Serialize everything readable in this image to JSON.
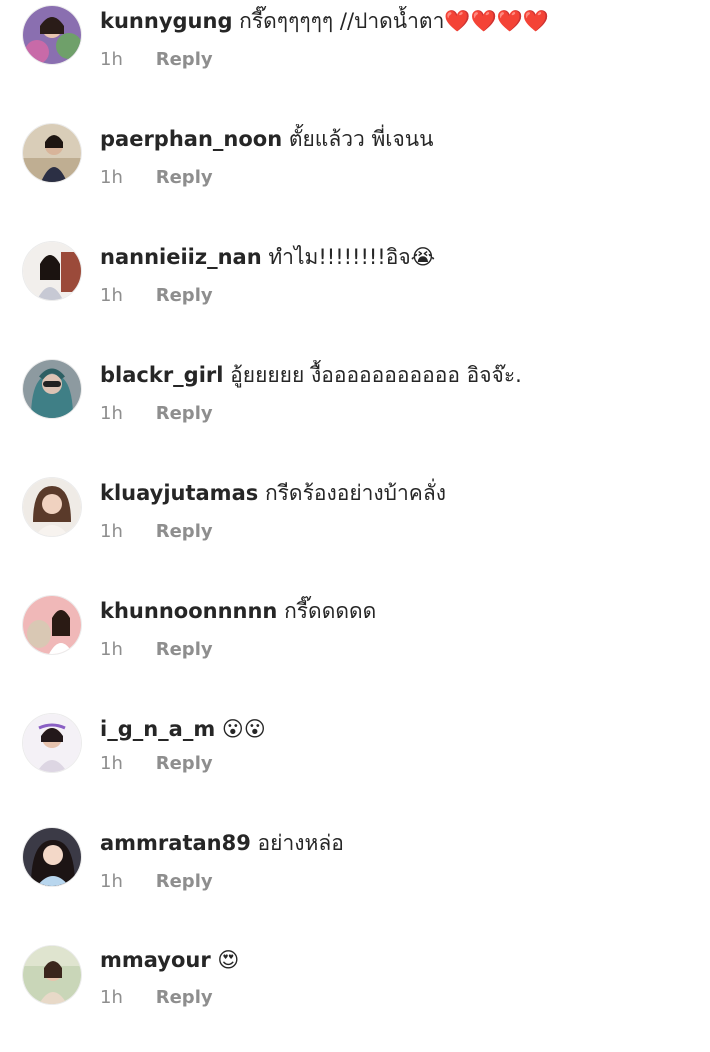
{
  "reply_label": "Reply",
  "comments": [
    {
      "username": "kunnygung",
      "text": "กรี๊ดๆๆๆๆๆ //ปาดน้ำตา❤️❤️❤️❤️",
      "time": "1h",
      "avatar": "avatar-kunnygung"
    },
    {
      "username": "paerphan_noon",
      "text": "ตั้ยแล้วว พี่เจนน",
      "time": "1h",
      "avatar": "avatar-paerphan_noon"
    },
    {
      "username": "nannieiiz_nan",
      "text": "ทำไม!!!!!!!!อิจ😭",
      "time": "1h",
      "avatar": "avatar-nannieiiz_nan"
    },
    {
      "username": "blackr_girl",
      "text": "อู้ยยยยย งื้อออออออออออ อิจจ๊ะ.",
      "time": "1h",
      "avatar": "avatar-blackr_girl"
    },
    {
      "username": "kluayjutamas",
      "text": "กรีดร้องอย่างบ้าคลั่ง",
      "time": "1h",
      "avatar": "avatar-kluayjutamas"
    },
    {
      "username": "khunnoonnnnn",
      "text": "กรี๊ดดดดด",
      "time": "1h",
      "avatar": "avatar-khunnoonnnnn"
    },
    {
      "username": "i_g_n_a_m",
      "text": "😮😮",
      "time": "1h",
      "avatar": "avatar-i_g_n_a_m"
    },
    {
      "username": "ammratan89",
      "text": "อย่างหล่อ",
      "time": "1h",
      "avatar": "avatar-ammratan89"
    },
    {
      "username": "mmayour",
      "text": "😍",
      "time": "1h",
      "avatar": "avatar-mmayour"
    }
  ]
}
